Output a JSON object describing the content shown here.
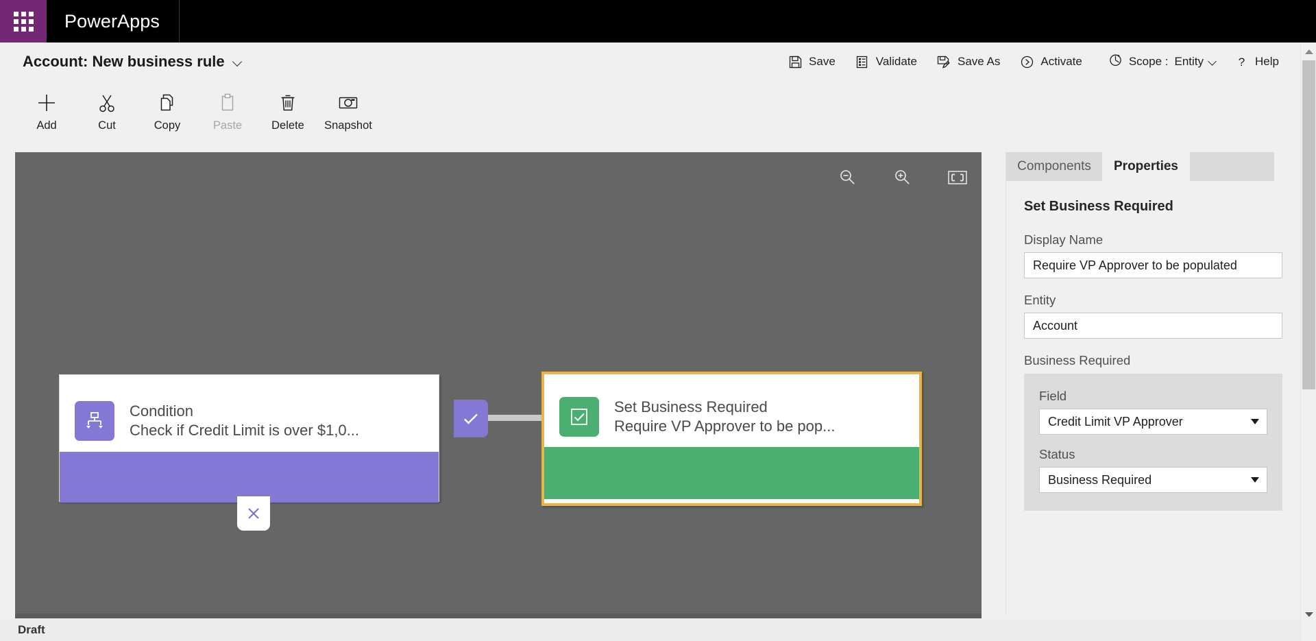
{
  "suite": {
    "waffle_label": "app-launcher",
    "brand": "PowerApps"
  },
  "command_bar": {
    "title_entity": "Account:",
    "title_rule": "New business rule",
    "title_full": "Account: New business rule",
    "actions": [
      {
        "label": "Save",
        "icon": "save-icon"
      },
      {
        "label": "Validate",
        "icon": "validate-icon"
      },
      {
        "label": "Save As",
        "icon": "save-as-icon"
      },
      {
        "label": "Activate",
        "icon": "activate-icon"
      }
    ],
    "scope": {
      "label": "Scope :",
      "value": "Entity",
      "icon": "scope-icon"
    },
    "help": {
      "label": "Help",
      "icon": "question-icon"
    }
  },
  "tool_ribbon": {
    "tools": [
      {
        "label": "Add",
        "icon": "plus-icon",
        "disabled": false
      },
      {
        "label": "Cut",
        "icon": "scissors-icon",
        "disabled": false
      },
      {
        "label": "Copy",
        "icon": "copy-icon",
        "disabled": false
      },
      {
        "label": "Paste",
        "icon": "clipboard-icon",
        "disabled": true
      },
      {
        "label": "Delete",
        "icon": "trash-icon",
        "disabled": false
      },
      {
        "label": "Snapshot",
        "icon": "camera-icon",
        "disabled": false
      }
    ]
  },
  "canvas": {
    "background_color": "#666666",
    "tools": [
      {
        "name": "zoom-out",
        "icon": "magnifier-minus-icon"
      },
      {
        "name": "zoom-in",
        "icon": "magnifier-plus-icon"
      },
      {
        "name": "fit-to-screen",
        "icon": "fit-screen-icon"
      }
    ],
    "nodes": {
      "condition": {
        "title": "Condition",
        "subtitle": "Check if Credit Limit is over $1,0...",
        "icon": "branch-icon",
        "color": "#8378d4",
        "selected": false
      },
      "action": {
        "title": "Set Business Required",
        "subtitle": "Require VP Approver to be pop...",
        "icon": "checkbox-icon",
        "color": "#4caf72",
        "selected": true,
        "selection_color": "#e8b54a"
      }
    },
    "branches": {
      "true_label": "true-branch",
      "true_icon": "checkmark-icon",
      "false_label": "false-branch",
      "false_icon": "cross-icon"
    }
  },
  "panel": {
    "tabs": [
      {
        "label": "Components",
        "active": false
      },
      {
        "label": "Properties",
        "active": true
      },
      {
        "label": "",
        "active": false
      }
    ],
    "heading": "Set Business Required",
    "display_name": {
      "label": "Display Name",
      "value": "Require VP Approver to be populated"
    },
    "entity": {
      "label": "Entity",
      "value": "Account"
    },
    "business_required": {
      "label": "Business Required",
      "field": {
        "label": "Field",
        "value": "Credit Limit VP Approver"
      },
      "status": {
        "label": "Status",
        "value": "Business Required"
      }
    }
  },
  "status_bar": {
    "state": "Draft"
  }
}
